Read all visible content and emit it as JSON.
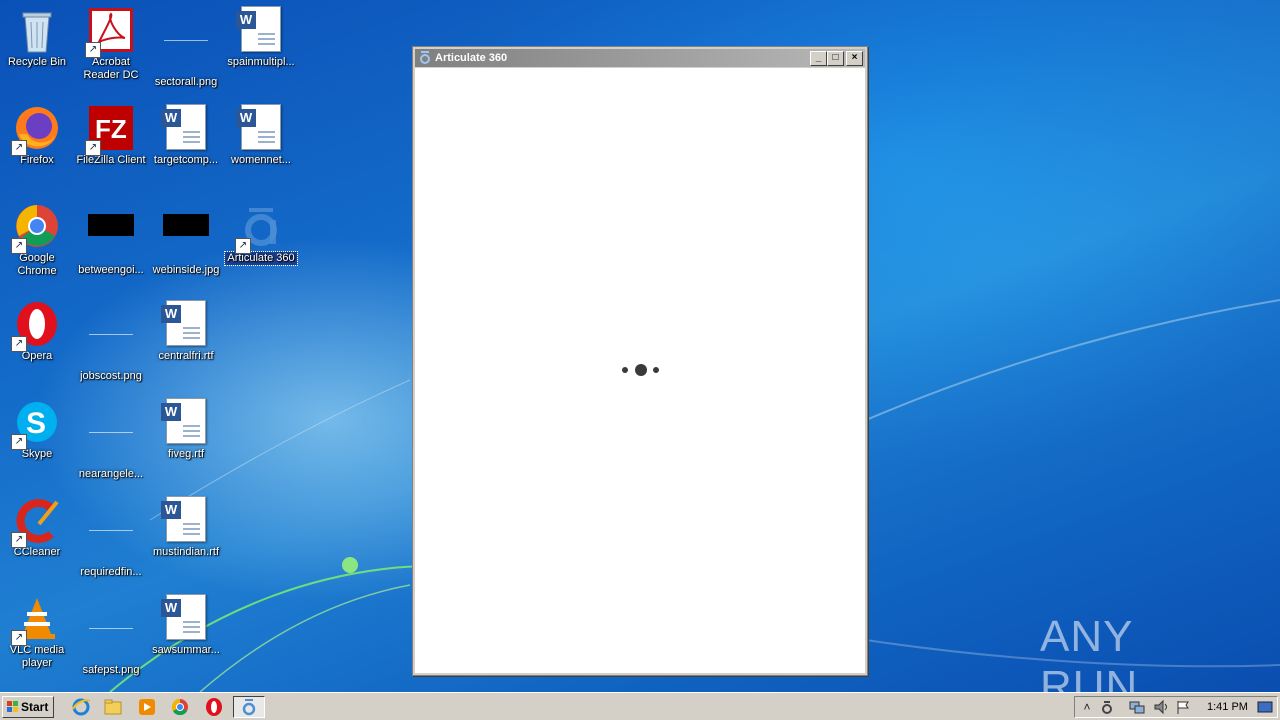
{
  "desktop": {
    "icons": [
      {
        "label": "Recycle Bin",
        "icon": "recycle-bin-icon"
      },
      {
        "label": "Acrobat Reader DC",
        "icon": "acrobat-reader-icon"
      },
      {
        "label": "sectorall.png",
        "icon": "image-file-icon"
      },
      {
        "label": "spainmultipl...",
        "icon": "word-document-icon"
      },
      {
        "label": "Firefox",
        "icon": "firefox-icon"
      },
      {
        "label": "FileZilla Client",
        "icon": "filezilla-icon"
      },
      {
        "label": "targetcomp...",
        "icon": "word-document-icon"
      },
      {
        "label": "womennet...",
        "icon": "word-document-icon"
      },
      {
        "label": "Google Chrome",
        "icon": "chrome-icon"
      },
      {
        "label": "betweengoi...",
        "icon": "image-file-icon"
      },
      {
        "label": "webinside.jpg",
        "icon": "image-file-icon"
      },
      {
        "label": "Articulate 360",
        "icon": "articulate-360-icon"
      },
      {
        "label": "Opera",
        "icon": "opera-icon"
      },
      {
        "label": "jobscost.png",
        "icon": "image-file-icon"
      },
      {
        "label": "centralfri.rtf",
        "icon": "word-document-icon"
      },
      {
        "label": "Skype",
        "icon": "skype-icon"
      },
      {
        "label": "nearangele...",
        "icon": "image-file-icon"
      },
      {
        "label": "fiveg.rtf",
        "icon": "word-document-icon"
      },
      {
        "label": "CCleaner",
        "icon": "ccleaner-icon"
      },
      {
        "label": "requiredfin...",
        "icon": "image-file-icon"
      },
      {
        "label": "mustindian.rtf",
        "icon": "word-document-icon"
      },
      {
        "label": "VLC media player",
        "icon": "vlc-icon"
      },
      {
        "label": "safepst.png",
        "icon": "image-file-icon"
      },
      {
        "label": "sawsummar...",
        "icon": "word-document-icon"
      }
    ]
  },
  "window": {
    "title": "Articulate 360",
    "buttons": {
      "minimize": "_",
      "maximize": "□",
      "close": "×"
    },
    "loading": true
  },
  "taskbar": {
    "start_label": "Start",
    "quick_launch": [
      "internet-explorer-icon",
      "windows-explorer-icon",
      "media-player-icon",
      "chrome-icon",
      "opera-icon",
      "articulate-360-icon"
    ],
    "tray_icons": [
      "show-hidden-icons",
      "articulate-tray-icon",
      "network-icon",
      "volume-icon",
      "action-center-flag-icon"
    ],
    "clock": "1:41 PM"
  },
  "watermark": "ANY RUN"
}
